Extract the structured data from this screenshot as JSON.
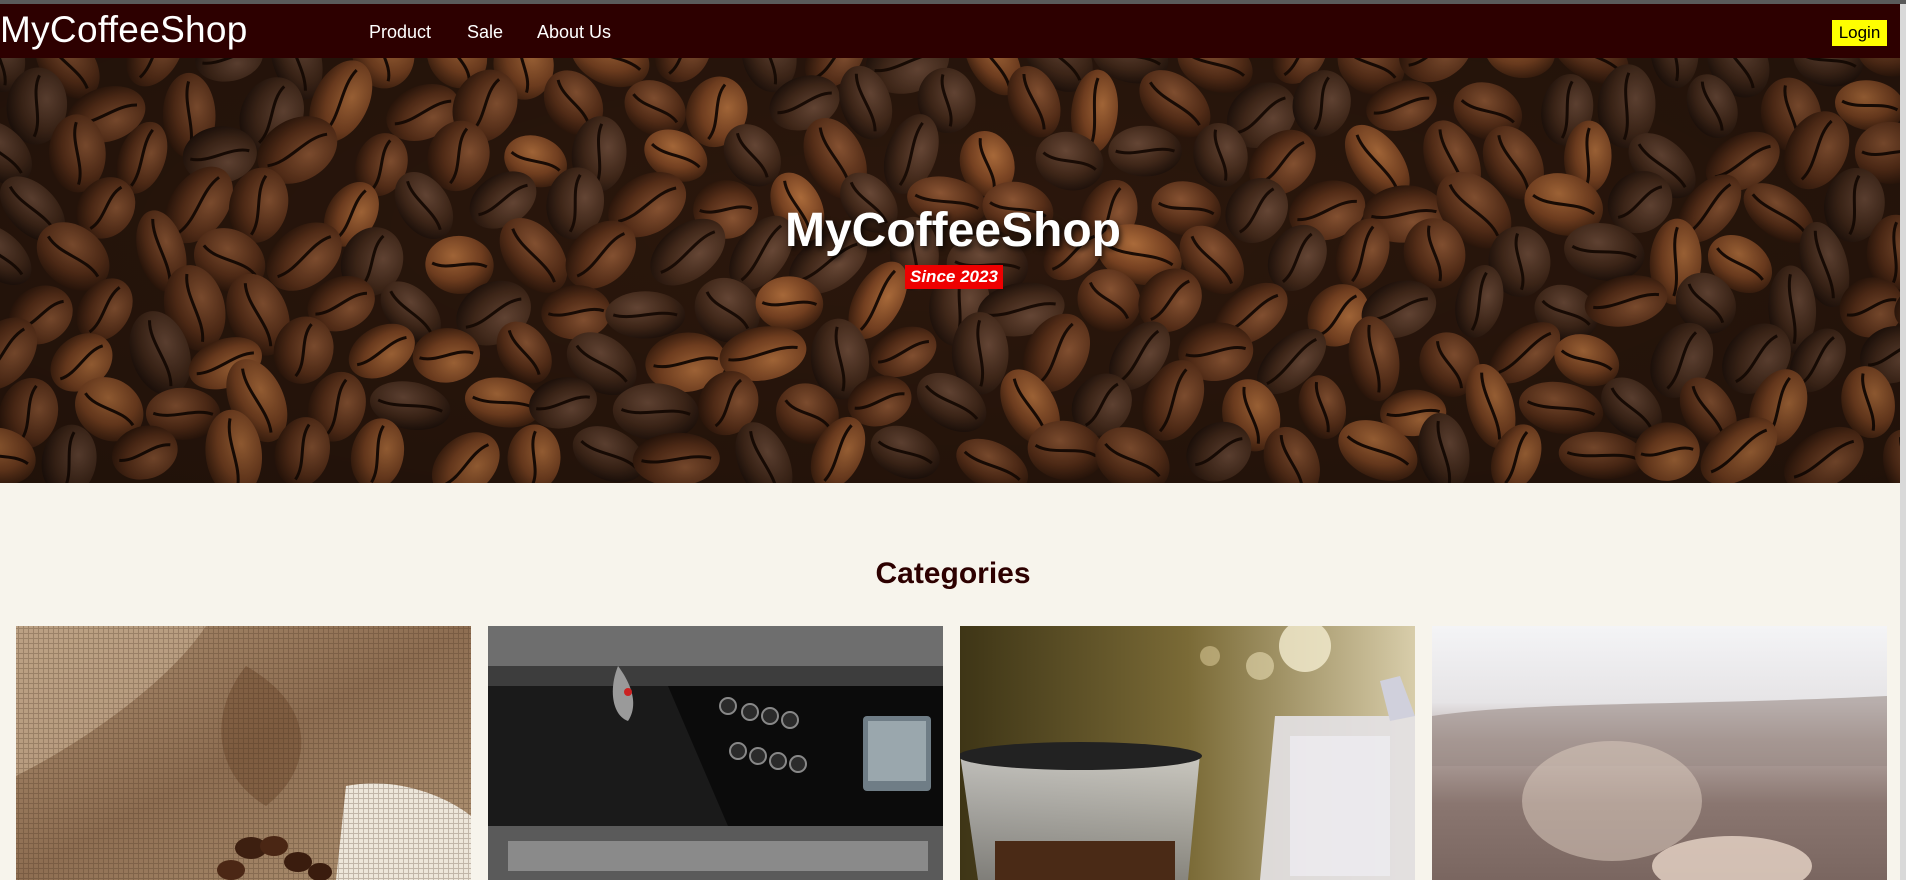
{
  "nav": {
    "brand": "MyCoffeeShop",
    "links": [
      {
        "label": "Product"
      },
      {
        "label": "Sale"
      },
      {
        "label": "About Us"
      }
    ],
    "login_label": "Login",
    "background": "#2d0000",
    "login_color": "#ffff00"
  },
  "hero": {
    "title": "MyCoffeeShop",
    "badge": "Since 2023",
    "badge_color": "#ee0000",
    "image": "coffee-beans-photo"
  },
  "categories": {
    "title": "Categories",
    "cards": [
      {
        "image": "burlap-sack-coffee-beans-photo"
      },
      {
        "image": "espresso-machine-photo"
      },
      {
        "image": "coffee-grinder-photo"
      },
      {
        "image": "outdoor-blurred-photo"
      }
    ]
  },
  "colors": {
    "page_background": "#f7f4ec",
    "heading": "#2d0000"
  }
}
